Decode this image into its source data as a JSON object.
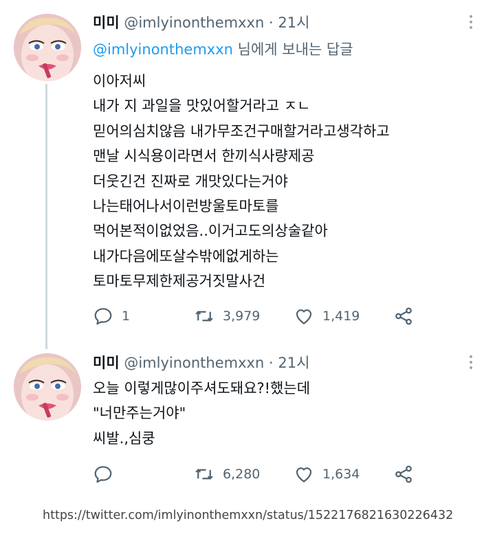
{
  "tweets": [
    {
      "name": "미미",
      "handle": "@imlyinonthemxxn",
      "dot": "·",
      "time": "21시",
      "replying_to_handle": "@imlyinonthemxxn",
      "replying_to_suffix": " 님에게 보내는 답글",
      "lines": [
        "이아저씨",
        "내가 지 과일을 맛있어할거라고 ㅈㄴ",
        "믿어의심치않음 내가무조건구매할거라고생각하고",
        "맨날 시식용이라면서 한끼식사량제공",
        "더웃긴건 진짜로 개맛있다는거야",
        "나는태어나서이런방울토마토를",
        "먹어본적이없었음..이거고도의상술같아",
        "내가다음에또살수밖에없게하는",
        "토마토무제한제공거짓말사건"
      ],
      "reply_count": "1",
      "retweet_count": "3,979",
      "like_count": "1,419"
    },
    {
      "name": "미미",
      "handle": "@imlyinonthemxxn",
      "dot": "·",
      "time": "21시",
      "lines": [
        "오늘 이렇게많이주셔도돼요?!했는데",
        "\"너만주는거야\"",
        "씨발.,심쿵"
      ],
      "retweet_count": "6,280",
      "like_count": "1,634"
    }
  ],
  "source_url": "https://twitter.com/imlyinonthemxxn/status/1522176821630226432",
  "icons": {
    "reply": "reply-icon",
    "retweet": "retweet-icon",
    "like": "heart-icon",
    "share": "share-icon",
    "more": "more-icon"
  },
  "colors": {
    "text": "#0f1419",
    "secondary": "#536471",
    "link": "#1d9bf0",
    "thread_line": "#cfd9de"
  }
}
